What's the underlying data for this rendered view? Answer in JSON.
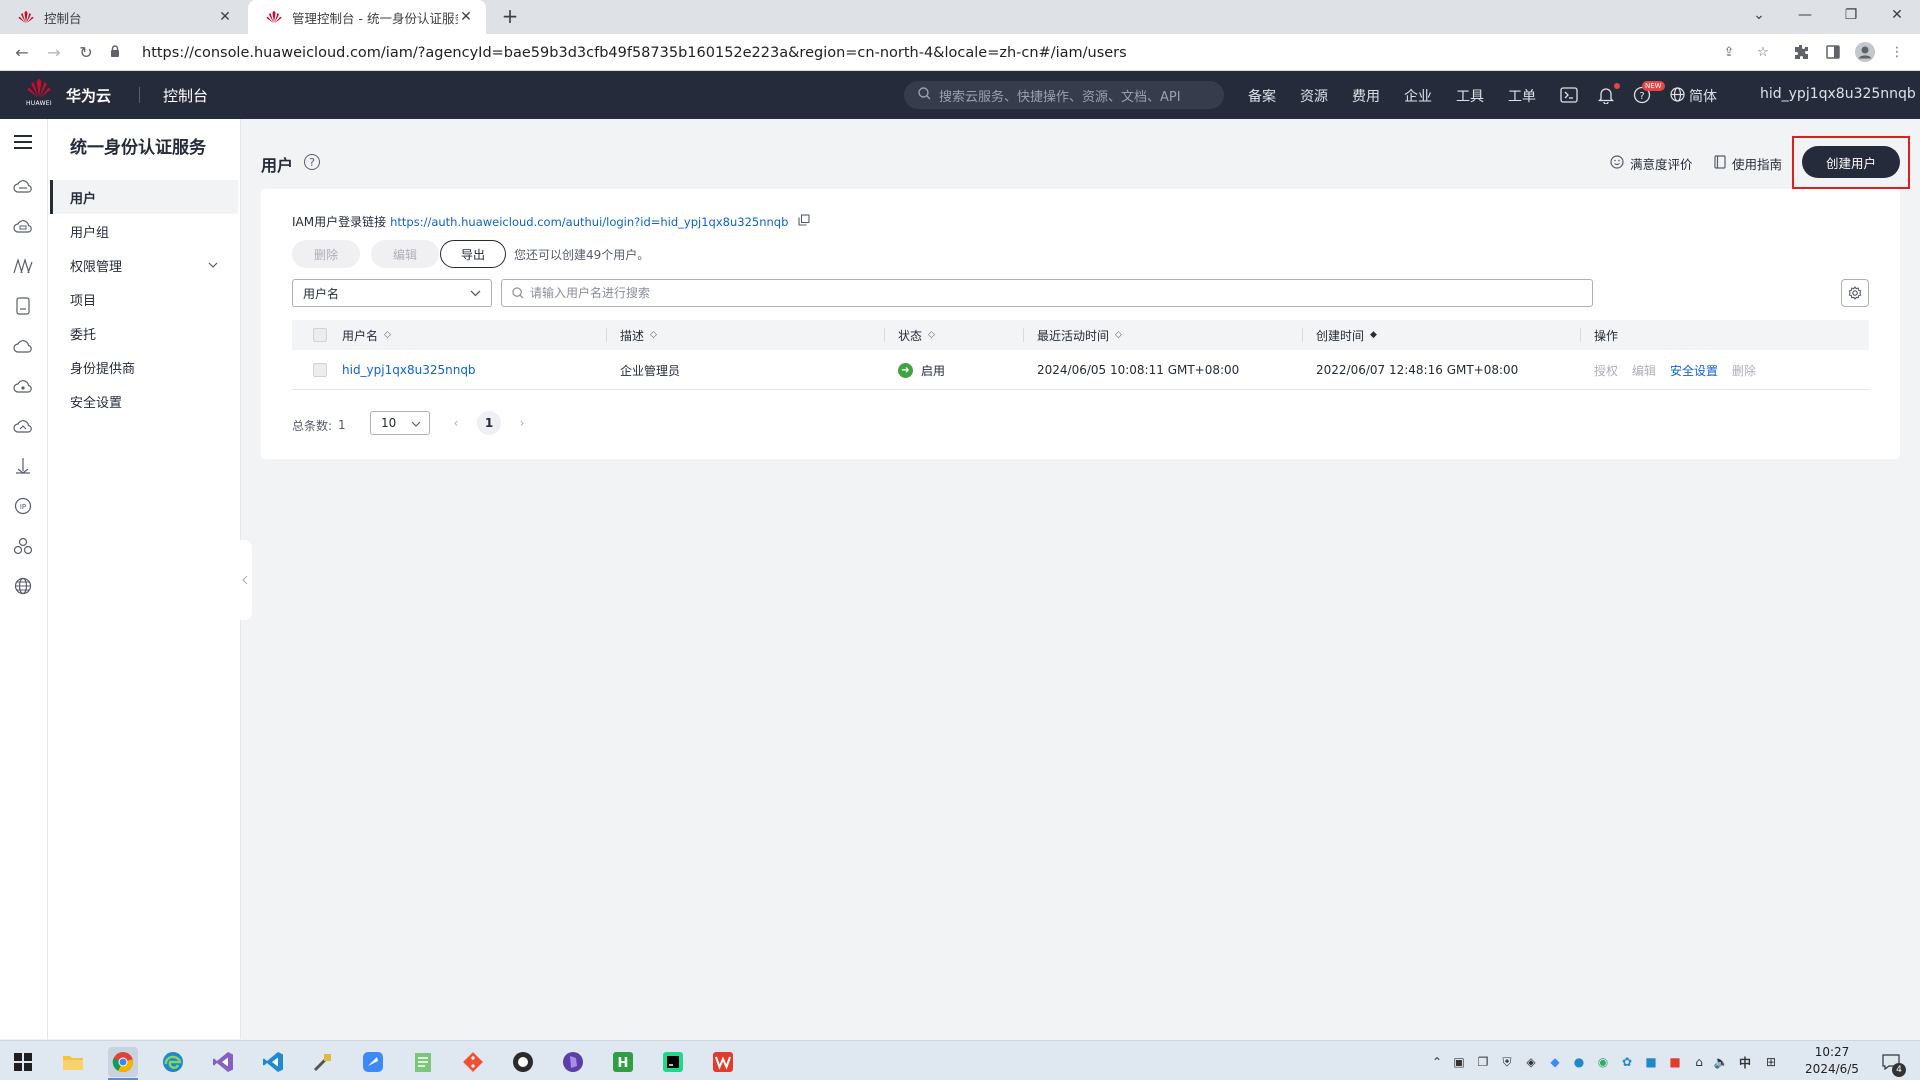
{
  "browser": {
    "tabs": [
      {
        "title": "控制台",
        "active": false
      },
      {
        "title": "管理控制台 - 统一身份认证服务",
        "active": true
      }
    ],
    "url": "https://console.huaweicloud.com/iam/?agencyId=bae59b3d3cfb49f58735b160152e223a&region=cn-north-4&locale=zh-cn#/iam/users"
  },
  "header": {
    "logo_text": "HUAWEI",
    "brand": "华为云",
    "console": "控制台",
    "search_placeholder": "搜索云服务、快捷操作、资源、文档、API",
    "nav": [
      "备案",
      "资源",
      "费用",
      "企业",
      "工具",
      "工单"
    ],
    "new_badge": "NEW",
    "lang": "简体",
    "username": "hid_ypj1qx8u325nnqb"
  },
  "sidebar": {
    "title": "统一身份认证服务",
    "items": [
      {
        "label": "用户",
        "active": true
      },
      {
        "label": "用户组"
      },
      {
        "label": "权限管理",
        "expandable": true
      },
      {
        "label": "项目"
      },
      {
        "label": "委托"
      },
      {
        "label": "身份提供商"
      },
      {
        "label": "安全设置"
      }
    ]
  },
  "main": {
    "title": "用户",
    "feedback": "满意度评价",
    "guide": "使用指南",
    "create_user": "创建用户",
    "login_label": "IAM用户登录链接",
    "login_link": "https://auth.huaweicloud.com/authui/login?id=hid_ypj1qx8u325nnqb",
    "buttons": {
      "delete": "删除",
      "edit": "编辑",
      "export": "导出"
    },
    "remaining": "您还可以创建49个用户。",
    "filter_field": "用户名",
    "search_placeholder": "请输入用户名进行搜索",
    "columns": [
      "用户名",
      "描述",
      "状态",
      "最近活动时间",
      "创建时间",
      "操作"
    ],
    "rows": [
      {
        "username": "hid_ypj1qx8u325nnqb",
        "description": "企业管理员",
        "status": "启用",
        "last_active": "2024/06/05 10:08:11 GMT+08:00",
        "created": "2022/06/07 12:48:16 GMT+08:00",
        "ops": [
          "授权",
          "编辑",
          "安全设置",
          "删除"
        ]
      }
    ],
    "pagination": {
      "total_label": "总条数:",
      "total": "1",
      "page_size": "10",
      "current_page": "1"
    }
  },
  "taskbar": {
    "time": "10:27",
    "date": "2024/6/5",
    "ime": "中",
    "notifications": "4"
  },
  "colors": {
    "brand_dark": "#252b3a",
    "link": "#0d62d4",
    "status_ok": "#3fa33f",
    "highlight": "#e02020"
  }
}
